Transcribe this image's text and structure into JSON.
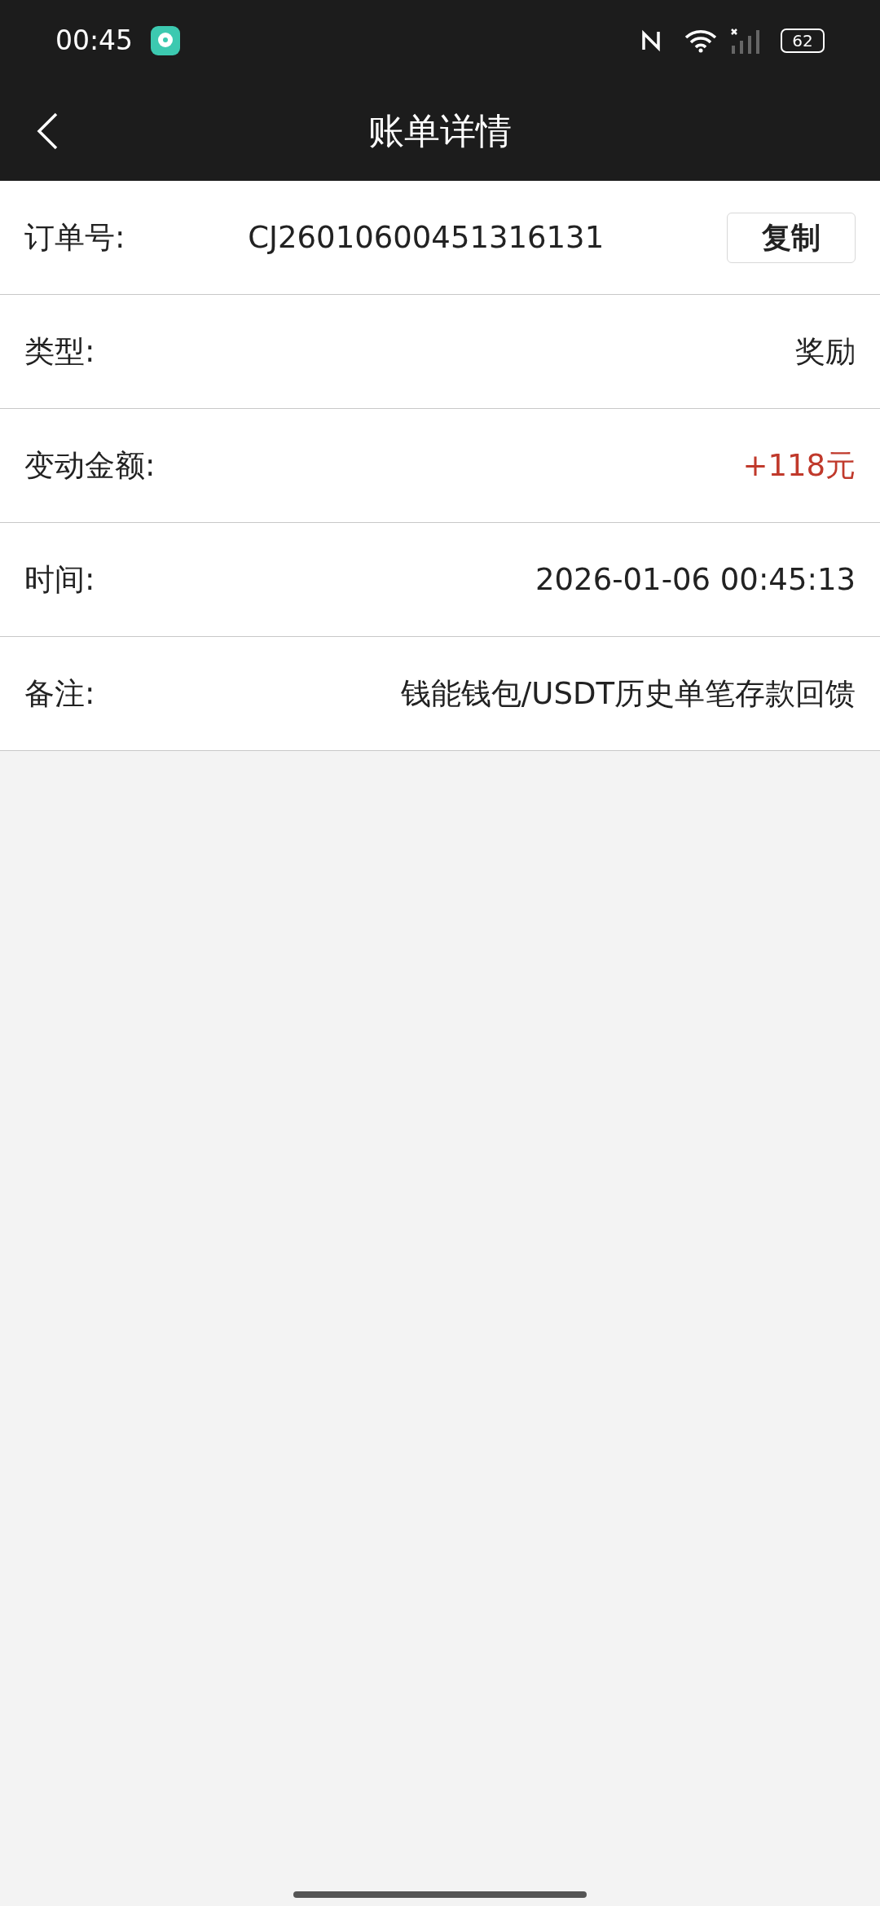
{
  "status_bar": {
    "time": "00:45",
    "battery": "62"
  },
  "header": {
    "title": "账单详情"
  },
  "rows": [
    {
      "kind": "copyable",
      "label": "订单号:",
      "value": "CJ26010600451316131",
      "button": "复制"
    },
    {
      "kind": "plain",
      "label": "类型:",
      "value": "奖励"
    },
    {
      "kind": "amount",
      "label": "变动金额:",
      "value": "+118元"
    },
    {
      "kind": "plain",
      "label": "时间:",
      "value": "2026-01-06 00:45:13"
    },
    {
      "kind": "plain",
      "label": "备注:",
      "value": "钱能钱包/USDT历史单笔存款回馈"
    }
  ]
}
